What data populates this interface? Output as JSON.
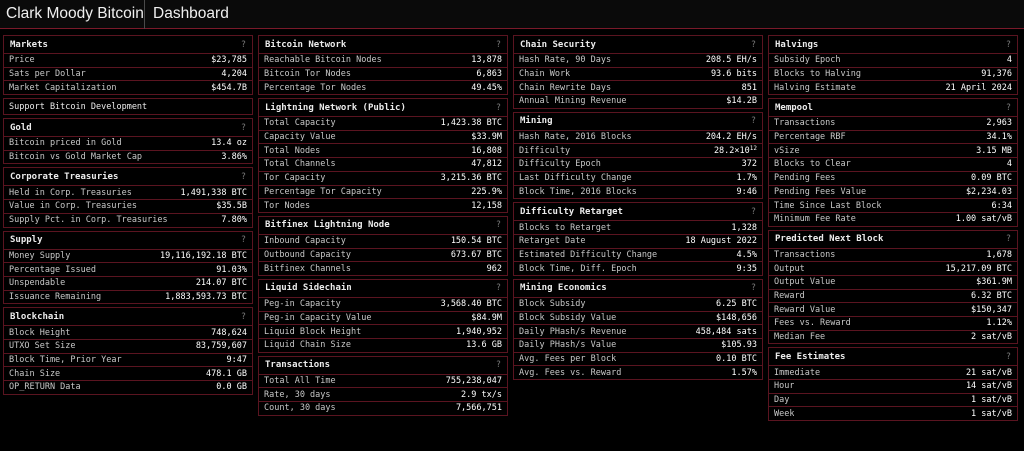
{
  "header": {
    "brand": "Clark Moody Bitcoin",
    "title": "Dashboard"
  },
  "help_glyph": "?",
  "columns": [
    [
      {
        "title": "Markets",
        "rows": [
          {
            "label": "Price",
            "value": "$23,785"
          },
          {
            "label": "Sats per Dollar",
            "value": "4,204"
          },
          {
            "label": "Market Capitalization",
            "value": "$454.7B"
          }
        ]
      },
      {
        "link": "Support Bitcoin Development"
      },
      {
        "title": "Gold",
        "rows": [
          {
            "label": "Bitcoin priced in Gold",
            "value": "13.4 oz"
          },
          {
            "label": "Bitcoin vs Gold Market Cap",
            "value": "3.86%"
          }
        ]
      },
      {
        "title": "Corporate Treasuries",
        "rows": [
          {
            "label": "Held in Corp. Treasuries",
            "value": "1,491,338 BTC"
          },
          {
            "label": "Value in Corp. Treasuries",
            "value": "$35.5B"
          },
          {
            "label": "Supply Pct. in Corp. Treasuries",
            "value": "7.80%"
          }
        ]
      },
      {
        "title": "Supply",
        "rows": [
          {
            "label": "Money Supply",
            "value": "19,116,192.18 BTC"
          },
          {
            "label": "Percentage Issued",
            "value": "91.03%"
          },
          {
            "label": "Unspendable",
            "value": "214.07 BTC"
          },
          {
            "label": "Issuance Remaining",
            "value": "1,883,593.73 BTC"
          }
        ]
      },
      {
        "title": "Blockchain",
        "rows": [
          {
            "label": "Block Height",
            "value": "748,624"
          },
          {
            "label": "UTXO Set Size",
            "value": "83,759,607"
          },
          {
            "label": "Block Time, Prior Year",
            "value": "9:47"
          },
          {
            "label": "Chain Size",
            "value": "478.1 GB"
          },
          {
            "label": "OP_RETURN Data",
            "value": "0.0 GB"
          }
        ]
      }
    ],
    [
      {
        "title": "Bitcoin Network",
        "rows": [
          {
            "label": "Reachable Bitcoin Nodes",
            "value": "13,878"
          },
          {
            "label": "Bitcoin Tor Nodes",
            "value": "6,863"
          },
          {
            "label": "Percentage Tor Nodes",
            "value": "49.45%"
          }
        ]
      },
      {
        "title": "Lightning Network (Public)",
        "rows": [
          {
            "label": "Total Capacity",
            "value": "1,423.38 BTC"
          },
          {
            "label": "Capacity Value",
            "value": "$33.9M"
          },
          {
            "label": "Total Nodes",
            "value": "16,808"
          },
          {
            "label": "Total Channels",
            "value": "47,812"
          },
          {
            "label": "Tor Capacity",
            "value": "3,215.36 BTC"
          },
          {
            "label": "Percentage Tor Capacity",
            "value": "225.9%"
          },
          {
            "label": "Tor Nodes",
            "value": "12,158"
          }
        ]
      },
      {
        "title": "Bitfinex Lightning Node",
        "rows": [
          {
            "label": "Inbound Capacity",
            "value": "150.54 BTC"
          },
          {
            "label": "Outbound Capacity",
            "value": "673.67 BTC"
          },
          {
            "label": "Bitfinex Channels",
            "value": "962"
          }
        ]
      },
      {
        "title": "Liquid Sidechain",
        "rows": [
          {
            "label": "Peg-in Capacity",
            "value": "3,568.40 BTC"
          },
          {
            "label": "Peg-in Capacity Value",
            "value": "$84.9M"
          },
          {
            "label": "Liquid Block Height",
            "value": "1,940,952"
          },
          {
            "label": "Liquid Chain Size",
            "value": "13.6 GB"
          }
        ]
      },
      {
        "title": "Transactions",
        "rows": [
          {
            "label": "Total All Time",
            "value": "755,238,047"
          },
          {
            "label": "Rate, 30 days",
            "value": "2.9 tx/s"
          },
          {
            "label": "Count, 30 days",
            "value": "7,566,751"
          }
        ]
      }
    ],
    [
      {
        "title": "Chain Security",
        "rows": [
          {
            "label": "Hash Rate, 90 Days",
            "value": "208.5 EH/s"
          },
          {
            "label": "Chain Work",
            "value": "93.6 bits"
          },
          {
            "label": "Chain Rewrite Days",
            "value": "851"
          },
          {
            "label": "Annual Mining Revenue",
            "value": "$14.2B"
          }
        ]
      },
      {
        "title": "Mining",
        "rows": [
          {
            "label": "Hash Rate, 2016 Blocks",
            "value": "204.2 EH/s"
          },
          {
            "label": "Difficulty",
            "value": "28.2×10",
            "sup": "12"
          },
          {
            "label": "Difficulty Epoch",
            "value": "372"
          },
          {
            "label": "Last Difficulty Change",
            "value": "1.7%"
          },
          {
            "label": "Block Time, 2016 Blocks",
            "value": "9:46"
          }
        ]
      },
      {
        "title": "Difficulty Retarget",
        "rows": [
          {
            "label": "Blocks to Retarget",
            "value": "1,328"
          },
          {
            "label": "Retarget Date",
            "value": "18 August 2022"
          },
          {
            "label": "Estimated Difficulty Change",
            "value": "4.5%"
          },
          {
            "label": "Block Time, Diff. Epoch",
            "value": "9:35"
          }
        ]
      },
      {
        "title": "Mining Economics",
        "rows": [
          {
            "label": "Block Subsidy",
            "value": "6.25 BTC"
          },
          {
            "label": "Block Subsidy Value",
            "value": "$148,656"
          },
          {
            "label": "Daily PHash/s Revenue",
            "value": "458,484 sats"
          },
          {
            "label": "Daily PHash/s Value",
            "value": "$105.93"
          },
          {
            "label": "Avg. Fees per Block",
            "value": "0.10 BTC"
          },
          {
            "label": "Avg. Fees vs. Reward",
            "value": "1.57%"
          }
        ]
      }
    ],
    [
      {
        "title": "Halvings",
        "rows": [
          {
            "label": "Subsidy Epoch",
            "value": "4"
          },
          {
            "label": "Blocks to Halving",
            "value": "91,376"
          },
          {
            "label": "Halving Estimate",
            "value": "21 April 2024"
          }
        ]
      },
      {
        "title": "Mempool",
        "rows": [
          {
            "label": "Transactions",
            "value": "2,963"
          },
          {
            "label": "Percentage RBF",
            "value": "34.1%"
          },
          {
            "label": "vSize",
            "value": "3.15 MB"
          },
          {
            "label": "Blocks to Clear",
            "value": "4"
          },
          {
            "label": "Pending Fees",
            "value": "0.09 BTC"
          },
          {
            "label": "Pending Fees Value",
            "value": "$2,234.03"
          },
          {
            "label": "Time Since Last Block",
            "value": "6:34"
          },
          {
            "label": "Minimum Fee Rate",
            "value": "1.00 sat/vB"
          }
        ]
      },
      {
        "title": "Predicted Next Block",
        "rows": [
          {
            "label": "Transactions",
            "value": "1,678"
          },
          {
            "label": "Output",
            "value": "15,217.09 BTC"
          },
          {
            "label": "Output Value",
            "value": "$361.9M"
          },
          {
            "label": "Reward",
            "value": "6.32 BTC"
          },
          {
            "label": "Reward Value",
            "value": "$150,347"
          },
          {
            "label": "Fees vs. Reward",
            "value": "1.12%"
          },
          {
            "label": "Median Fee",
            "value": "2 sat/vB"
          }
        ]
      },
      {
        "title": "Fee Estimates",
        "rows": [
          {
            "label": "Immediate",
            "value": "21 sat/vB"
          },
          {
            "label": "Hour",
            "value": "14 sat/vB"
          },
          {
            "label": "Day",
            "value": "1 sat/vB"
          },
          {
            "label": "Week",
            "value": "1 sat/vB"
          }
        ]
      }
    ]
  ]
}
